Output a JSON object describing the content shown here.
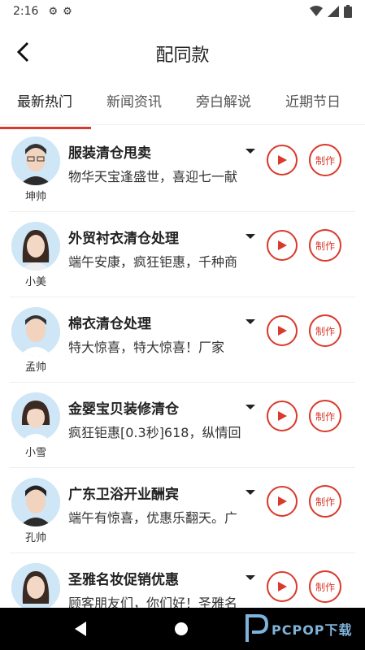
{
  "status_bar": {
    "time": "2:16"
  },
  "header": {
    "title": "配同款"
  },
  "tabs": [
    {
      "label": "最新热门",
      "active": true
    },
    {
      "label": "新闻资讯",
      "active": false
    },
    {
      "label": "旁白解说",
      "active": false
    },
    {
      "label": "近期节日",
      "active": false
    }
  ],
  "items": [
    {
      "name": "坤帅",
      "title": "服装清仓甩卖",
      "desc": "物华天宝逢盛世，喜迎七一献",
      "make_label": "制作",
      "avatar": "male-glasses"
    },
    {
      "name": "小美",
      "title": "外贸衬衣清仓处理",
      "desc": "端午安康，疯狂钜惠，千种商",
      "make_label": "制作",
      "avatar": "female-long"
    },
    {
      "name": "孟帅",
      "title": "棉衣清仓处理",
      "desc": "特大惊喜，特大惊喜！厂家",
      "make_label": "制作",
      "avatar": "male"
    },
    {
      "name": "小雪",
      "title": "金婴宝贝装修清仓",
      "desc": "疯狂钜惠[0.3秒]618，纵情回",
      "make_label": "制作",
      "avatar": "female-bob"
    },
    {
      "name": "孔帅",
      "title": "广东卫浴开业酬宾",
      "desc": "端午有惊喜，优惠乐翻天。广",
      "make_label": "制作",
      "avatar": "male"
    },
    {
      "name": "",
      "title": "圣雅名妆促销优惠",
      "desc": "顾客朋友们，你们好！圣雅名",
      "make_label": "制作",
      "avatar": "female-long"
    }
  ],
  "watermark": {
    "text": "PCPOP下载"
  },
  "colors": {
    "accent": "#d93a2b"
  }
}
